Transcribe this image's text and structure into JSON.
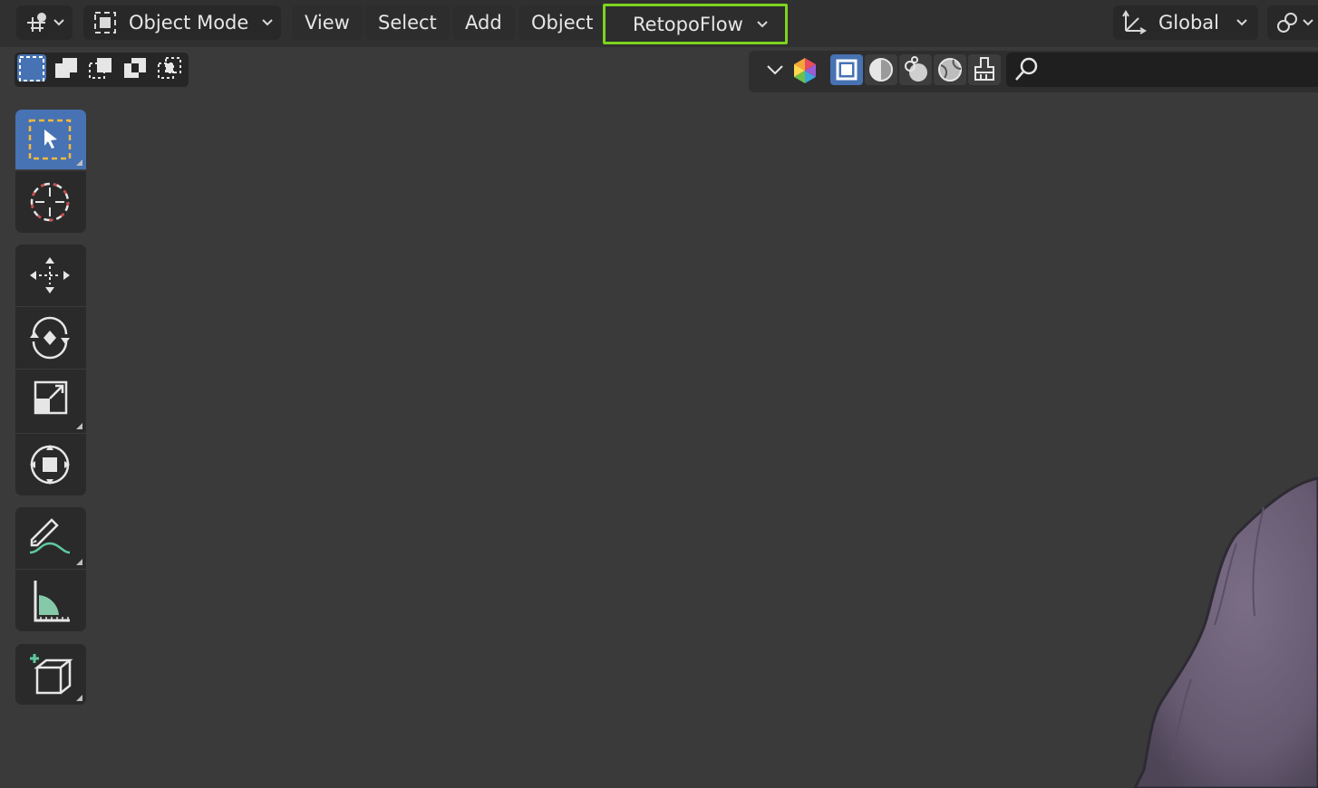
{
  "header": {
    "editor_type_icon": "viewport-editor-icon",
    "mode": {
      "label": "Object Mode",
      "icon": "object-mode-icon"
    },
    "menus": [
      "View",
      "Select",
      "Add",
      "Object"
    ],
    "addon_menu": {
      "label": "RetopoFlow",
      "highlight_color": "#7ed321"
    },
    "transform_orientation": {
      "label": "Global",
      "icon": "transform-axes-icon"
    },
    "snap_icon": "link-snap-icon"
  },
  "select_modes": [
    "select-new-icon",
    "select-extend-icon",
    "select-subtract-icon",
    "select-invert-icon",
    "select-intersect-icon"
  ],
  "viewport_shading": {
    "gizmo_icon": "color-gizmo-icon",
    "modes": [
      "wireframe-shading-icon",
      "solid-shading-icon",
      "material-preview-icon",
      "rendered-shading-icon",
      "texture-paint-icon"
    ],
    "active_index": 0,
    "search_icon": "search-icon"
  },
  "toolbar": {
    "tools": [
      {
        "name": "select-box-tool",
        "icon": "select-box-icon",
        "active": true
      },
      {
        "name": "cursor-tool",
        "icon": "cursor-icon"
      },
      {
        "name": "move-tool",
        "icon": "move-icon"
      },
      {
        "name": "rotate-tool",
        "icon": "rotate-icon"
      },
      {
        "name": "scale-tool",
        "icon": "scale-icon"
      },
      {
        "name": "transform-tool",
        "icon": "transform-icon"
      },
      {
        "name": "annotate-tool",
        "icon": "annotate-icon"
      },
      {
        "name": "measure-tool",
        "icon": "measure-icon"
      },
      {
        "name": "add-cube-tool",
        "icon": "add-cube-icon"
      }
    ]
  },
  "colors": {
    "viewport_bg": "#3a3a3a",
    "active_tool": "#4772b3",
    "mesh": "#6f6378"
  }
}
